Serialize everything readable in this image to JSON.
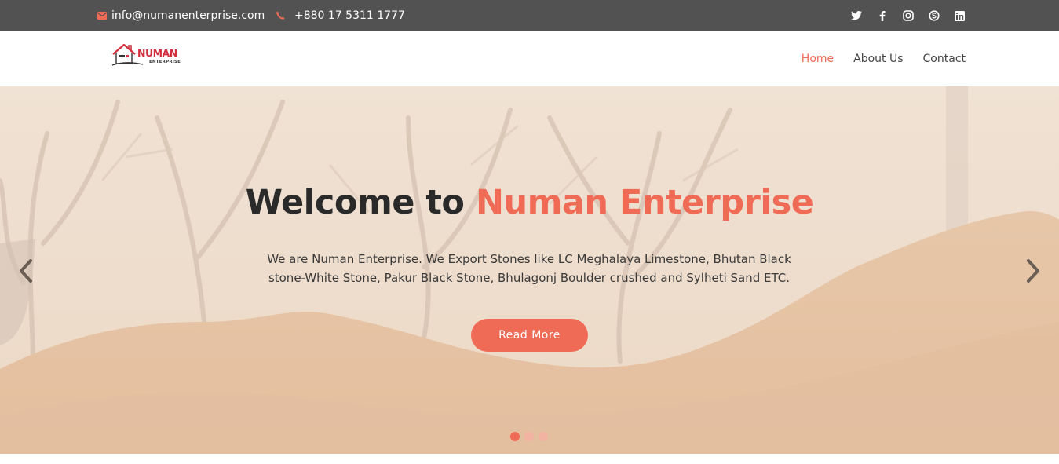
{
  "topbar": {
    "email": "info@numanenterprise.com",
    "phone": "+880 17 5311 1777",
    "socials": [
      "twitter-icon",
      "facebook-icon",
      "instagram-icon",
      "skype-icon",
      "linkedin-icon"
    ]
  },
  "logo": {
    "name": "NUMAN",
    "tagline": "ENTERPRISE"
  },
  "nav": {
    "items": [
      {
        "label": "Home",
        "active": true
      },
      {
        "label": "About Us",
        "active": false
      },
      {
        "label": "Contact",
        "active": false
      }
    ]
  },
  "hero": {
    "title_prefix": "Welcome to",
    "title_accent": "Numan Enterprise",
    "description": "We are Numan Enterprise. We Export Stones like LC Meghalaya Limestone, Bhutan Black stone-White Stone, Pakur Black Stone, Bhulagonj Boulder crushed and Sylheti Sand ETC.",
    "button_label": "Read More",
    "slides_total": 3,
    "slide_active": 1
  },
  "colors": {
    "accent": "#f06b55",
    "topbar_bg": "#525252",
    "brand_red": "#d42d3c",
    "text_dark": "#2a2a2a"
  }
}
